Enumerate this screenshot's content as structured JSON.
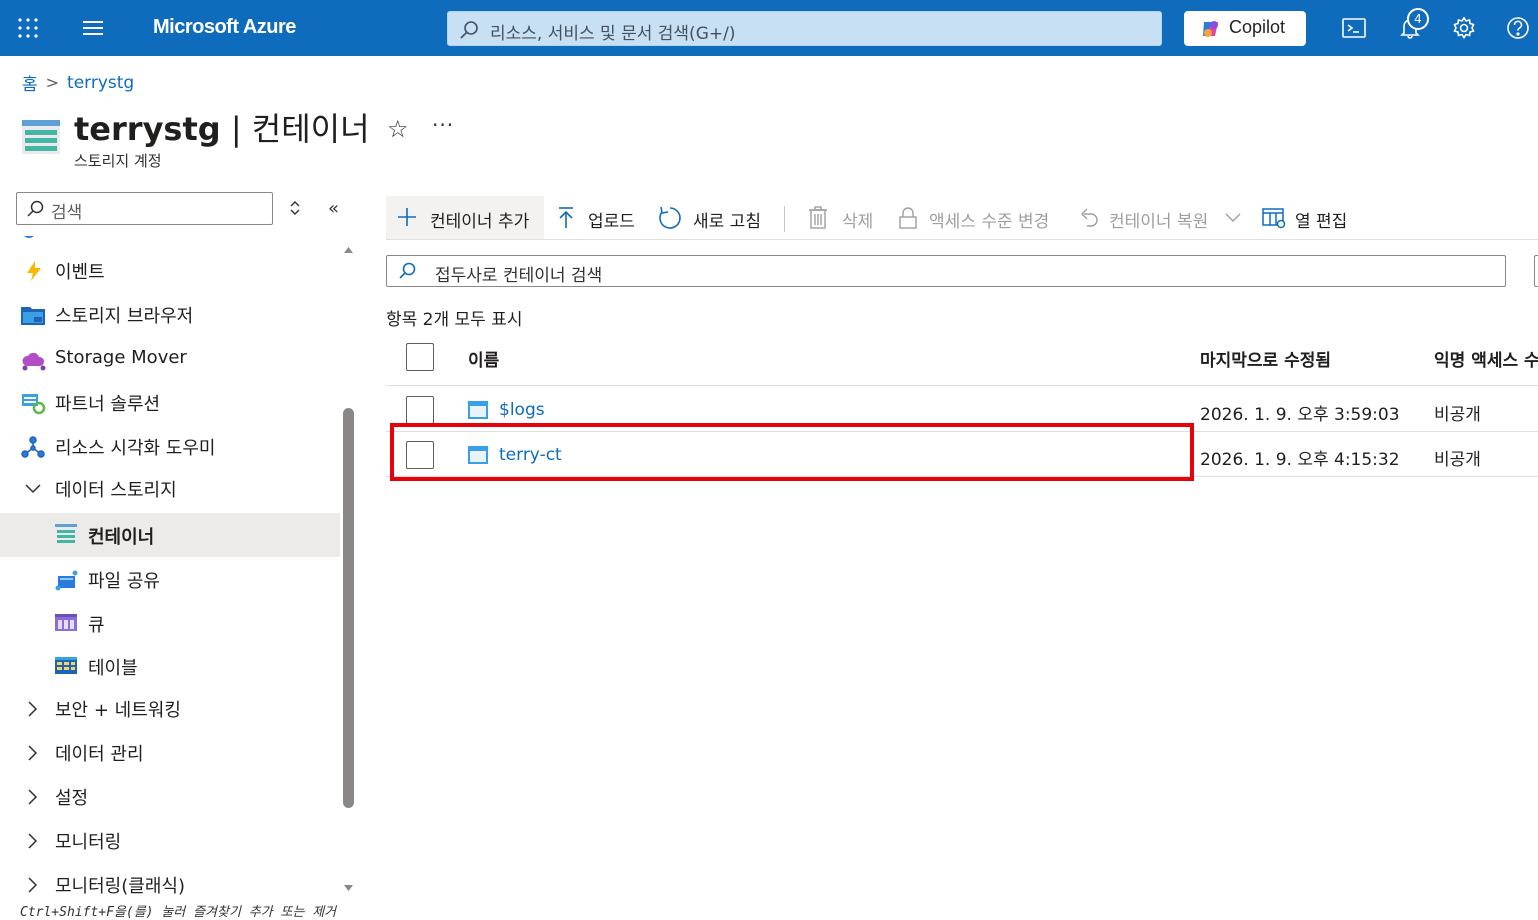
{
  "topbar": {
    "brand": "Microsoft Azure",
    "search_placeholder": "리소스, 서비스 및 문서 검색(G+/)",
    "copilot_label": "Copilot",
    "notification_count": "4",
    "icons": [
      "waffle-icon",
      "hamburger-menu-icon",
      "search-icon",
      "copilot-logo-icon",
      "cloud-shell-icon",
      "bell-icon",
      "gear-icon",
      "help-icon"
    ],
    "bar_color": "#0f6cbd"
  },
  "breadcrumb": {
    "home": "홈",
    "current": "terrystg"
  },
  "header": {
    "resource": "terrystg",
    "separator": " | ",
    "page": "컨테이너",
    "subtitle": "스토리지 계정",
    "star": "☆",
    "more": "···"
  },
  "sidebar": {
    "search_placeholder": "검색",
    "collapse_glyph": "«",
    "items": [
      {
        "label": "이벤트",
        "icon": "lightning-icon"
      },
      {
        "label": "스토리지 브라우저",
        "icon": "storage-browser-icon"
      },
      {
        "label": "Storage Mover",
        "icon": "storage-mover-icon"
      },
      {
        "label": "파트너 솔루션",
        "icon": "partner-solutions-icon"
      },
      {
        "label": "리소스 시각화 도우미",
        "icon": "resource-visualizer-icon"
      },
      {
        "label": "데이터 스토리지",
        "icon": "chevron-down-icon",
        "expanded": true
      },
      {
        "label": "컨테이너",
        "icon": "container-icon",
        "selected": true
      },
      {
        "label": "파일 공유",
        "icon": "file-share-icon"
      },
      {
        "label": "큐",
        "icon": "queue-icon"
      },
      {
        "label": "테이블",
        "icon": "table-icon"
      },
      {
        "label": "보안 + 네트워킹",
        "icon": "chevron-right-icon"
      },
      {
        "label": "데이터 관리",
        "icon": "chevron-right-icon"
      },
      {
        "label": "설정",
        "icon": "chevron-right-icon"
      },
      {
        "label": "모니터링",
        "icon": "chevron-right-icon"
      },
      {
        "label": "모니터링(클래식)",
        "icon": "chevron-right-icon"
      }
    ],
    "footer_hint": "Ctrl+Shift+F을(를) 눌러 즐겨찾기 추가 또는 제거"
  },
  "toolbar": {
    "add_container": "컨테이너 추가",
    "upload": "업로드",
    "refresh": "새로 고침",
    "delete": "삭제",
    "change_access": "액세스 수준 변경",
    "restore_container": "컨테이너 복원",
    "edit_columns": "열 편집"
  },
  "filter": {
    "placeholder": "접두사로 컨테이너 검색"
  },
  "grid": {
    "count_label": "항목 2개 모두 표시",
    "columns": [
      "이름",
      "마지막으로 수정됨",
      "익명 액세스 수"
    ],
    "rows": [
      {
        "name": "$logs",
        "modified": "2026. 1. 9. 오후 3:59:03",
        "access": "비공개"
      },
      {
        "name": "terry-ct",
        "modified": "2026. 1. 9. 오후 4:15:32",
        "access": "비공개"
      }
    ]
  },
  "highlight_color": "#e8000b"
}
